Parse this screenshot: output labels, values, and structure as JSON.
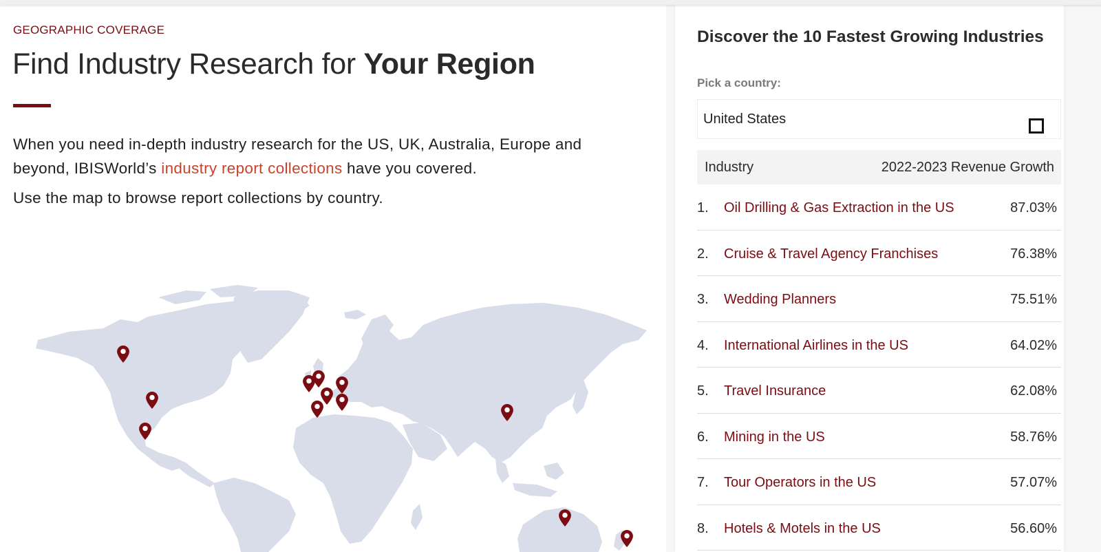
{
  "left": {
    "eyebrow": "GEOGRAPHIC COVERAGE",
    "headline_light": "Find Industry Research for ",
    "headline_bold": "Your Region",
    "intro_before": "When you need in-depth industry research for the US, UK, Australia, Europe and beyond, IBISWorld’s ",
    "intro_link": "industry report collections",
    "intro_after": " have you covered.",
    "browse": "Use the map to browse report collections by country."
  },
  "map": {
    "land_color": "#d8dde9",
    "pin_color": "#7b0d12",
    "pins": [
      "pin-canada",
      "pin-us",
      "pin-mexico",
      "pin-ireland",
      "pin-uk",
      "pin-netherlands",
      "pin-france",
      "pin-switzerland",
      "pin-spain",
      "pin-germany",
      "pin-china",
      "pin-australia",
      "pin-new-zealand"
    ]
  },
  "right": {
    "title": "Discover the 10 Fastest Growing Industries",
    "pick_label": "Pick a country:",
    "selected_country": "United States",
    "col_industry": "Industry",
    "col_growth": "2022-2023 Revenue Growth",
    "rows": [
      {
        "num": "1.",
        "name": "Oil Drilling & Gas Extraction in the US",
        "value": "87.03%"
      },
      {
        "num": "2.",
        "name": "Cruise & Travel Agency Franchises",
        "value": "76.38%"
      },
      {
        "num": "3.",
        "name": "Wedding Planners",
        "value": "75.51%"
      },
      {
        "num": "4.",
        "name": "International Airlines in the US",
        "value": "64.02%"
      },
      {
        "num": "5.",
        "name": "Travel Insurance",
        "value": "62.08%"
      },
      {
        "num": "6.",
        "name": "Mining in the US",
        "value": "58.76%"
      },
      {
        "num": "7.",
        "name": "Tour Operators in the US",
        "value": "57.07%"
      },
      {
        "num": "8.",
        "name": "Hotels & Motels in the US",
        "value": "56.60%"
      }
    ]
  },
  "colors": {
    "brand": "#7b0d12",
    "link": "#c9422a",
    "text": "#1f1f1f"
  }
}
